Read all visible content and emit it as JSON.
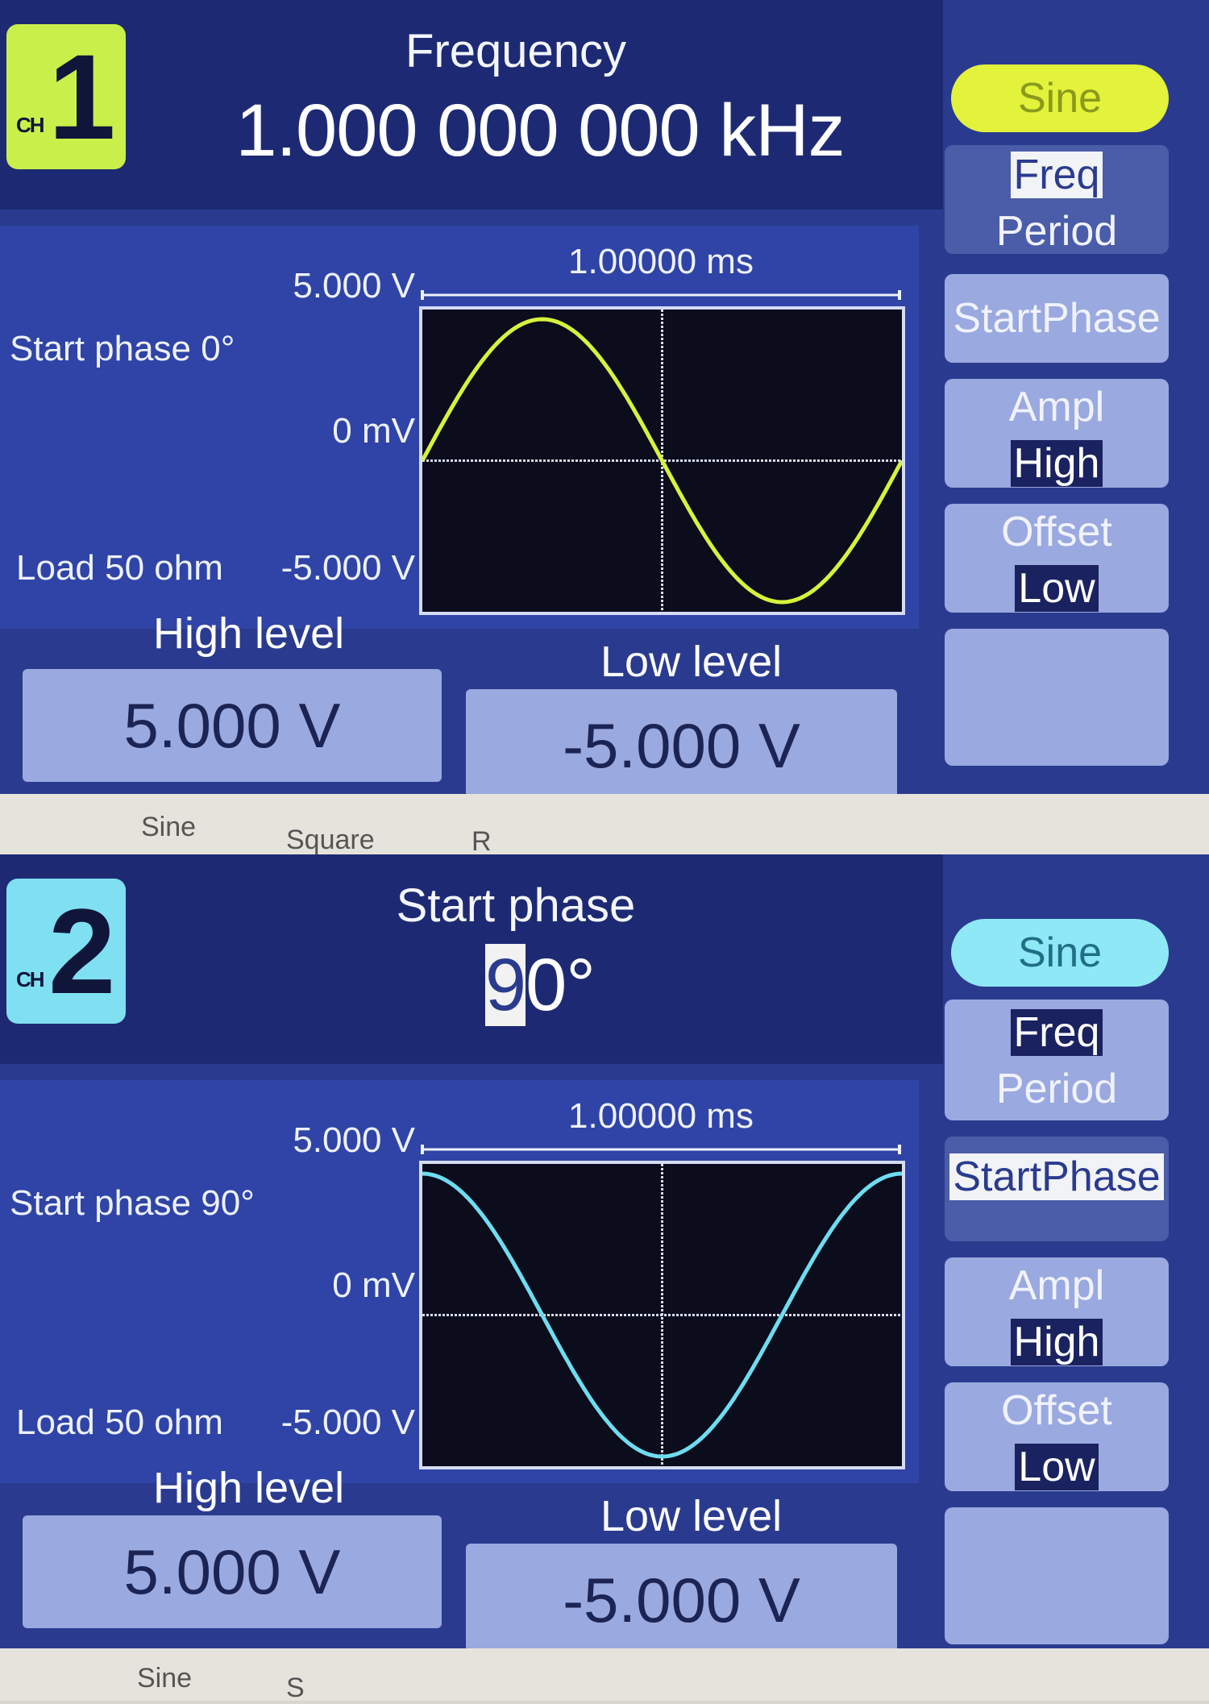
{
  "screens": [
    {
      "channel": {
        "small": "CH",
        "number": "1",
        "color": "#c9f04a"
      },
      "param_title": "Frequency",
      "param_value": "1.000 000 000 kHz",
      "waveform_button": "Sine",
      "menu": {
        "freq": "Freq",
        "period": "Period",
        "start_phase": "StartPhase",
        "ampl": "Ampl",
        "high": "High",
        "offset": "Offset",
        "low": "Low"
      },
      "graph": {
        "start_phase_text": "Start phase 0°",
        "load_text": "Load 50 ohm",
        "y_top": "5.000 V",
        "y_mid": "0 mV",
        "y_bottom": "-5.000 V",
        "time_span": "1.00000 ms",
        "trace_color": "#d6f23c",
        "phase_deg": 0
      },
      "high_level": {
        "label": "High level",
        "value": "5.000 V"
      },
      "low_level": {
        "label": "Low level",
        "value": "-5.000 V"
      }
    },
    {
      "channel": {
        "small": "CH",
        "number": "2",
        "color": "#7fe0f2"
      },
      "param_title": "Start phase",
      "param_value_cursor": "9",
      "param_value_rest": "0°",
      "waveform_button": "Sine",
      "menu": {
        "freq": "Freq",
        "period": "Period",
        "start_phase": "StartPhase",
        "ampl": "Ampl",
        "high": "High",
        "offset": "Offset",
        "low": "Low"
      },
      "graph": {
        "start_phase_text": "Start phase 90°",
        "load_text": "Load 50 ohm",
        "y_top": "5.000 V",
        "y_mid": "0 mV",
        "y_bottom": "-5.000 V",
        "time_span": "1.00000 ms",
        "trace_color": "#6fdcf0",
        "phase_deg": 90
      },
      "high_level": {
        "label": "High level",
        "value": "5.000 V"
      },
      "low_level": {
        "label": "Low level",
        "value": "-5.000 V"
      }
    }
  ],
  "bezel": {
    "top_labels": [
      "Sine",
      "Square",
      "R"
    ],
    "bottom_labels": [
      "Sine",
      "S"
    ]
  }
}
